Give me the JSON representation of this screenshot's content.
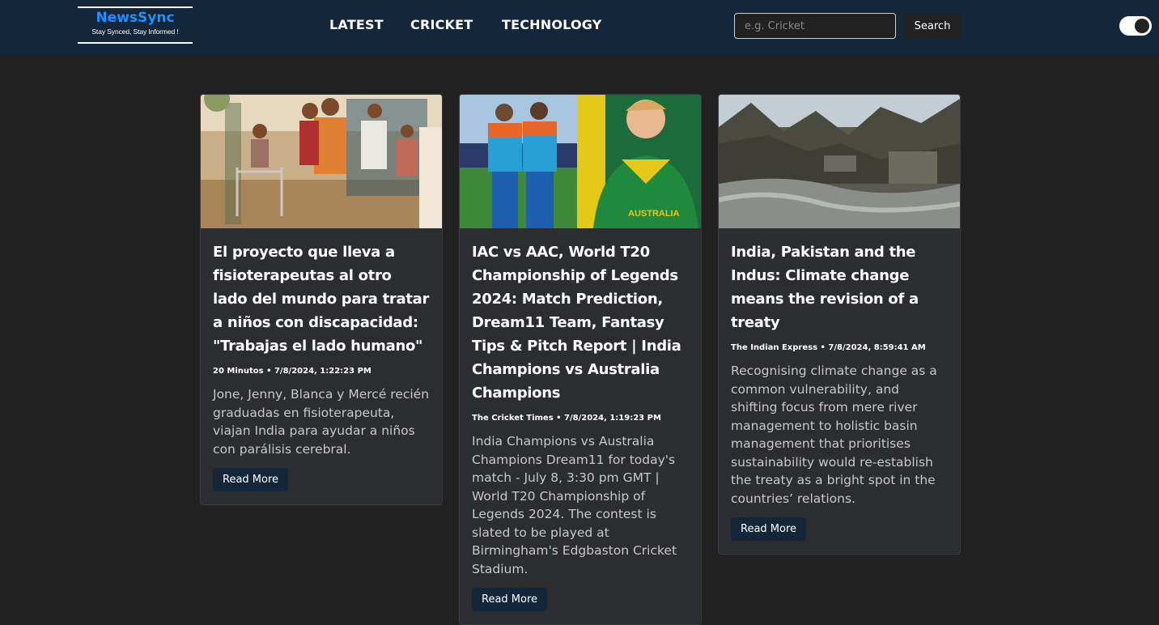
{
  "brand": {
    "name": "NewsSync",
    "tagline": "Stay Synced, Stay Informed !"
  },
  "nav": {
    "links": [
      "LATEST",
      "CRICKET",
      "TECHNOLOGY"
    ]
  },
  "search": {
    "placeholder": "e.g. Cricket",
    "value": "",
    "button_label": "Search"
  },
  "theme_toggle": {
    "state": "dark"
  },
  "articles": [
    {
      "title": "El proyecto que lleva a fisioterapeutas al otro lado del mundo para tratar a niños con discapacidad: \"Trabajas el lado humano\"",
      "meta": "20 Minutos • 7/8/2024, 1:22:23 PM",
      "description": "Jone, Jenny, Blanca y Mercé recién graduadas en fisioterapeuta, viajan India para ayudar a niños con parálisis cerebral.",
      "button_label": "Read More"
    },
    {
      "title": "IAC vs AAC, World T20 Championship of Legends 2024: Match Prediction, Dream11 Team, Fantasy Tips & Pitch Report | India Champions vs Australia Champions",
      "meta": "The Cricket Times • 7/8/2024, 1:19:23 PM",
      "description": "India Champions vs Australia Champions Dream11 for today's match - July 8, 3:30 pm GMT | World T20 Championship of Legends 2024. The contest is slated to be played at Birmingham's Edgbaston Cricket Stadium.",
      "button_label": "Read More"
    },
    {
      "title": "India, Pakistan and the Indus: Climate change means the revision of a treaty",
      "meta": "The Indian Express • 7/8/2024, 8:59:41 AM",
      "description": "Recognising climate change as a common vulnerability, and shifting focus from mere river management to holistic basin management that prioritises sustainability would re-establish the treaty as a bright spot in the countries’ relations.",
      "button_label": "Read More"
    }
  ]
}
